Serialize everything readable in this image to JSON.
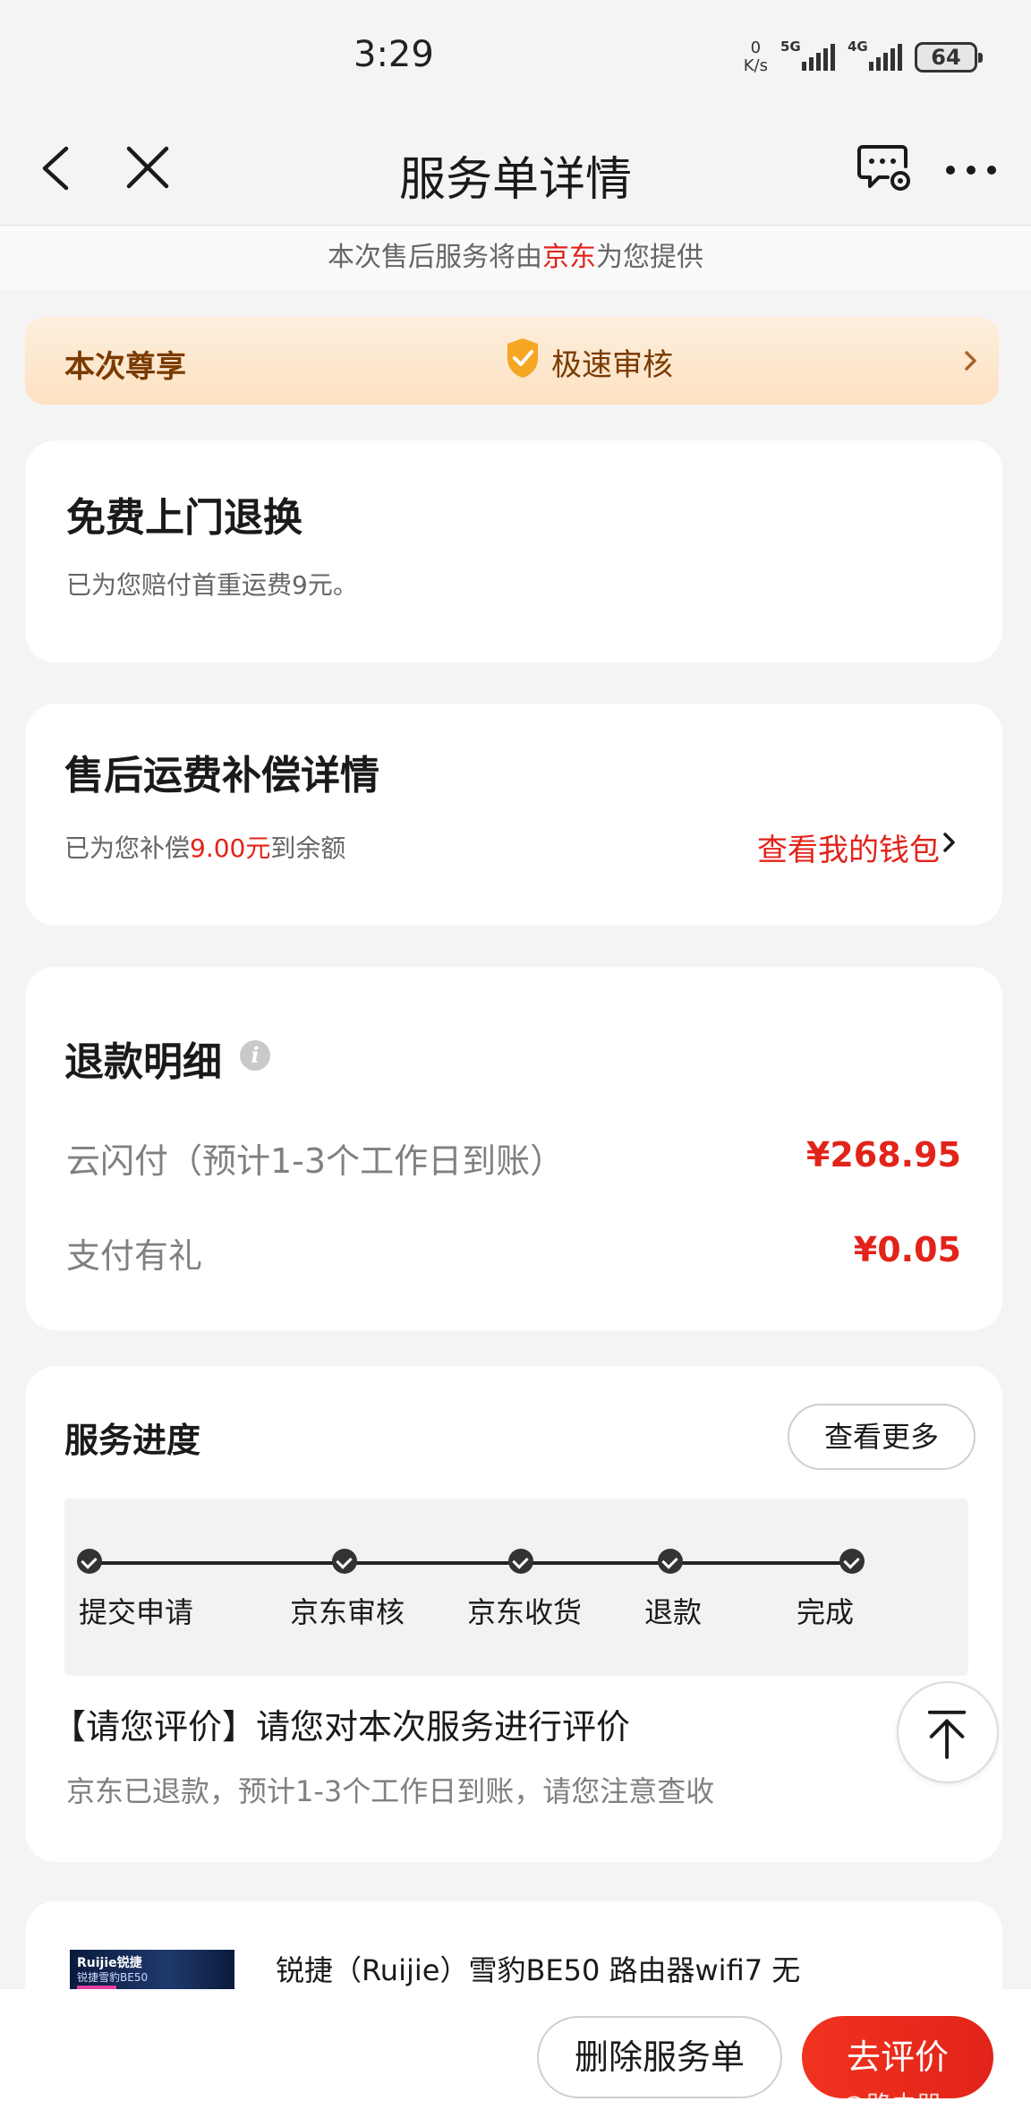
{
  "status_bar": {
    "time": "3:29",
    "net_speed_value": "0",
    "net_speed_unit": "K/s",
    "signal_1": "5G",
    "signal_2": "4G",
    "battery": "64"
  },
  "nav": {
    "title": "服务单详情"
  },
  "provider": {
    "prefix": "本次售后服务将由",
    "provider": "京东",
    "suffix": "为您提供"
  },
  "privilege": {
    "label": "本次尊享",
    "benefit": "极速审核"
  },
  "free_return": {
    "title": "免费上门退换",
    "desc": "已为您赔付首重运费9元。"
  },
  "shipping_comp": {
    "title": "售后运费补偿详情",
    "desc_prefix": "已为您补偿",
    "amount": "9.00元",
    "desc_suffix": "到余额",
    "wallet_link": "查看我的钱包"
  },
  "refund": {
    "title": "退款明细",
    "rows": [
      {
        "label": "云闪付（预计1-3个工作日到账）",
        "amount": "¥268.95"
      },
      {
        "label": "支付有礼",
        "amount": "¥0.05"
      }
    ]
  },
  "progress": {
    "title": "服务进度",
    "more_button": "查看更多",
    "steps": [
      "提交申请",
      "京东审核",
      "京东收货",
      "退款",
      "完成"
    ],
    "eval_title": "【请您评价】请您对本次服务进行评价",
    "eval_desc": "京东已退款，预计1-3个工作日到账，请您注意查收"
  },
  "product": {
    "image_logo": "Ruijie锐捷",
    "image_model": "锐捷雪豹BE50",
    "name": "锐捷（Ruijie）雪豹BE50 路由器wifi7 无"
  },
  "bottom": {
    "delete_button": "删除服务单",
    "review_button": "去评价",
    "watermark": "@路由器"
  },
  "colors": {
    "accent_red": "#e2231a",
    "privilege_text": "#7a3b00",
    "background": "#f4f4f4"
  },
  "icons": [
    "back-arrow-icon",
    "close-icon",
    "message-settings-icon",
    "more-icon",
    "shield-check-icon",
    "chevron-right-icon",
    "info-icon",
    "back-to-top-icon",
    "check-icon"
  ]
}
